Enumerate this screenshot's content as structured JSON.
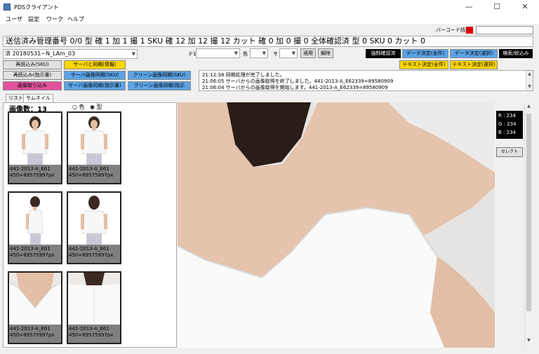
{
  "window": {
    "title": "PDSクライアント",
    "minimize": "—",
    "maximize": "☐",
    "close": "✕"
  },
  "menu": [
    "ユーザ",
    "設定",
    "ワーク",
    "ヘルプ"
  ],
  "barcode": {
    "label": "バーコード読込",
    "indicator_color": "#e00000",
    "value": ""
  },
  "status_line": "送信済み管理番号 0/0  型 確 1 加 1 撮 1  SKU 確 12 加 12 撮 12  カット 確 0 加 0 撮 0  全体確認済  型 0 SKU 0 カット 0",
  "filters": {
    "folder": "済 20180531~N_LAm_03",
    "te_label": "テ1",
    "te_value": "",
    "color_label": "色",
    "color_value": "",
    "size_label": "サ",
    "size_value": "",
    "apply": "適用",
    "clear": "解除"
  },
  "buttons": {
    "reload_sku": "再読込み(SKU)",
    "server_sync_info": "サーバと同期(情報)",
    "reload_instruction": "再読込み(指示書)",
    "server_image_sync_sku": "サーバ画像同期(SKU)",
    "clean_image_sync_sku": "クリーン画像同期(SKU)",
    "image_import": "画像取り込み",
    "server_image_sync_instr": "サーバ画像同期(指示書)",
    "clean_image_sync_instr": "クリーン画像同期(指示",
    "force_confirm": "強制確認済",
    "data_decide_all": "データ決定(全件)",
    "data_decide_select": "データ決定(選択)",
    "search_narrow": "検索/絞込み",
    "text_decide_all": "テキスト決定(全件)",
    "text_decide_select": "テキスト決定(選択)"
  },
  "log": [
    "21:12:38 同期処理が完了しました。",
    "21:06:05 サーバからの画像取得を終了しました。441-2013-A_E62339=89580909",
    "21:06:04 サーバからの画像取得を開始します。441-2013-A_E62339=89580909"
  ],
  "tabs": {
    "list": "リスト",
    "thumbnail": "サムネイル"
  },
  "thumbs": {
    "count_label": "画像数：13",
    "radio_color": "色",
    "radio_type": "型",
    "items": [
      {
        "line1": "441-2013-A_E61",
        "line2": "450=89575997px"
      },
      {
        "line1": "441-2013-A_E61",
        "line2": "450=89575997px"
      },
      {
        "line1": "441-2013-A_E61",
        "line2": "450=89575997px"
      },
      {
        "line1": "441-2013-A_E61",
        "line2": "450=89575997px"
      },
      {
        "line1": "441-2013-A_E61",
        "line2": "450=89575997px"
      },
      {
        "line1": "441-2013-A_E61",
        "line2": "450=89575997px"
      }
    ]
  },
  "rgb": {
    "r": "R : 234",
    "g": "G : 234",
    "b": "B : 234"
  },
  "select_button": "セレクト"
}
